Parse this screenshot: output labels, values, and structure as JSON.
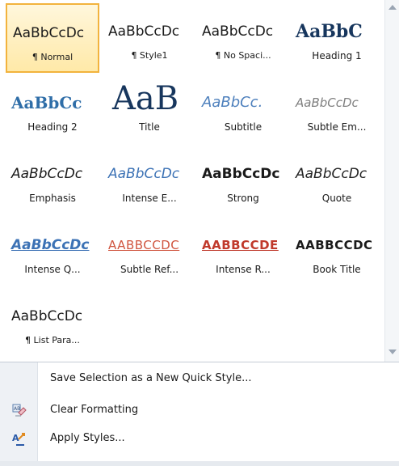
{
  "gallery": {
    "styles": [
      {
        "preview": "AaBbCcDc",
        "name": "¶ Normal"
      },
      {
        "preview": "AaBbCcDc",
        "name": "¶ Style1"
      },
      {
        "preview": "AaBbCcDc",
        "name": "¶ No Spaci..."
      },
      {
        "preview": "AaBbC",
        "name": "Heading 1"
      },
      {
        "preview": "AaBbCc",
        "name": "Heading 2"
      },
      {
        "preview": "AaB",
        "name": "Title"
      },
      {
        "preview": "AaBbCc.",
        "name": "Subtitle"
      },
      {
        "preview": "AaBbCcDc",
        "name": "Subtle Em..."
      },
      {
        "preview": "AaBbCcDc",
        "name": "Emphasis"
      },
      {
        "preview": "AaBbCcDc",
        "name": "Intense E..."
      },
      {
        "preview": "AaBbCcDc",
        "name": "Strong"
      },
      {
        "preview": "AaBbCcDc",
        "name": "Quote"
      },
      {
        "preview": "AaBbCcDc",
        "name": "Intense Q..."
      },
      {
        "preview": "AABBCCDC",
        "name": "Subtle Ref..."
      },
      {
        "preview": "AABBCCDE",
        "name": "Intense R..."
      },
      {
        "preview": "AABBCCDC",
        "name": "Book Title"
      },
      {
        "preview": "AaBbCcDc",
        "name": "¶ List Para..."
      }
    ],
    "selected_style": "¶ Normal"
  },
  "menu": {
    "save_selection": "Save Selection as a New Quick Style...",
    "clear_formatting": "Clear Formatting",
    "apply_styles": "Apply Styles..."
  },
  "colors": {
    "selection_border": "#f2b33d",
    "selection_fill": "#ffe9a8",
    "heading_blue": "#17365d",
    "accent_blue": "#4f81bd",
    "reference_red": "#c0392b"
  }
}
